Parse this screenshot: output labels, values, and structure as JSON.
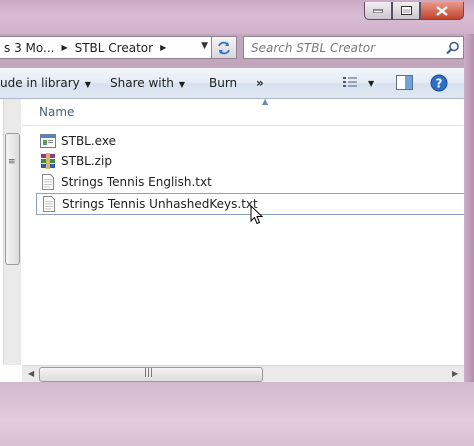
{
  "address_bar": {
    "crumbs": [
      "s 3 Mo...",
      "STBL Creator"
    ]
  },
  "search": {
    "placeholder": "Search STBL Creator"
  },
  "toolbar": {
    "include_label": "ude in library",
    "share_label": "Share with",
    "burn_label": "Burn",
    "more_label": "»"
  },
  "column_header": {
    "name": "Name"
  },
  "files": [
    {
      "name": "STBL.exe",
      "icon": "exe-icon"
    },
    {
      "name": "STBL.zip",
      "icon": "winrar-archive-icon"
    },
    {
      "name": "Strings Tennis English.txt",
      "icon": "text-file-icon"
    },
    {
      "name": "Strings Tennis UnhashedKeys.txt",
      "icon": "text-file-icon",
      "selected": true
    }
  ],
  "colors": {
    "toolbar": "#dfe7f2",
    "frame": "#c3a5bc",
    "header_text": "#4c607a"
  }
}
